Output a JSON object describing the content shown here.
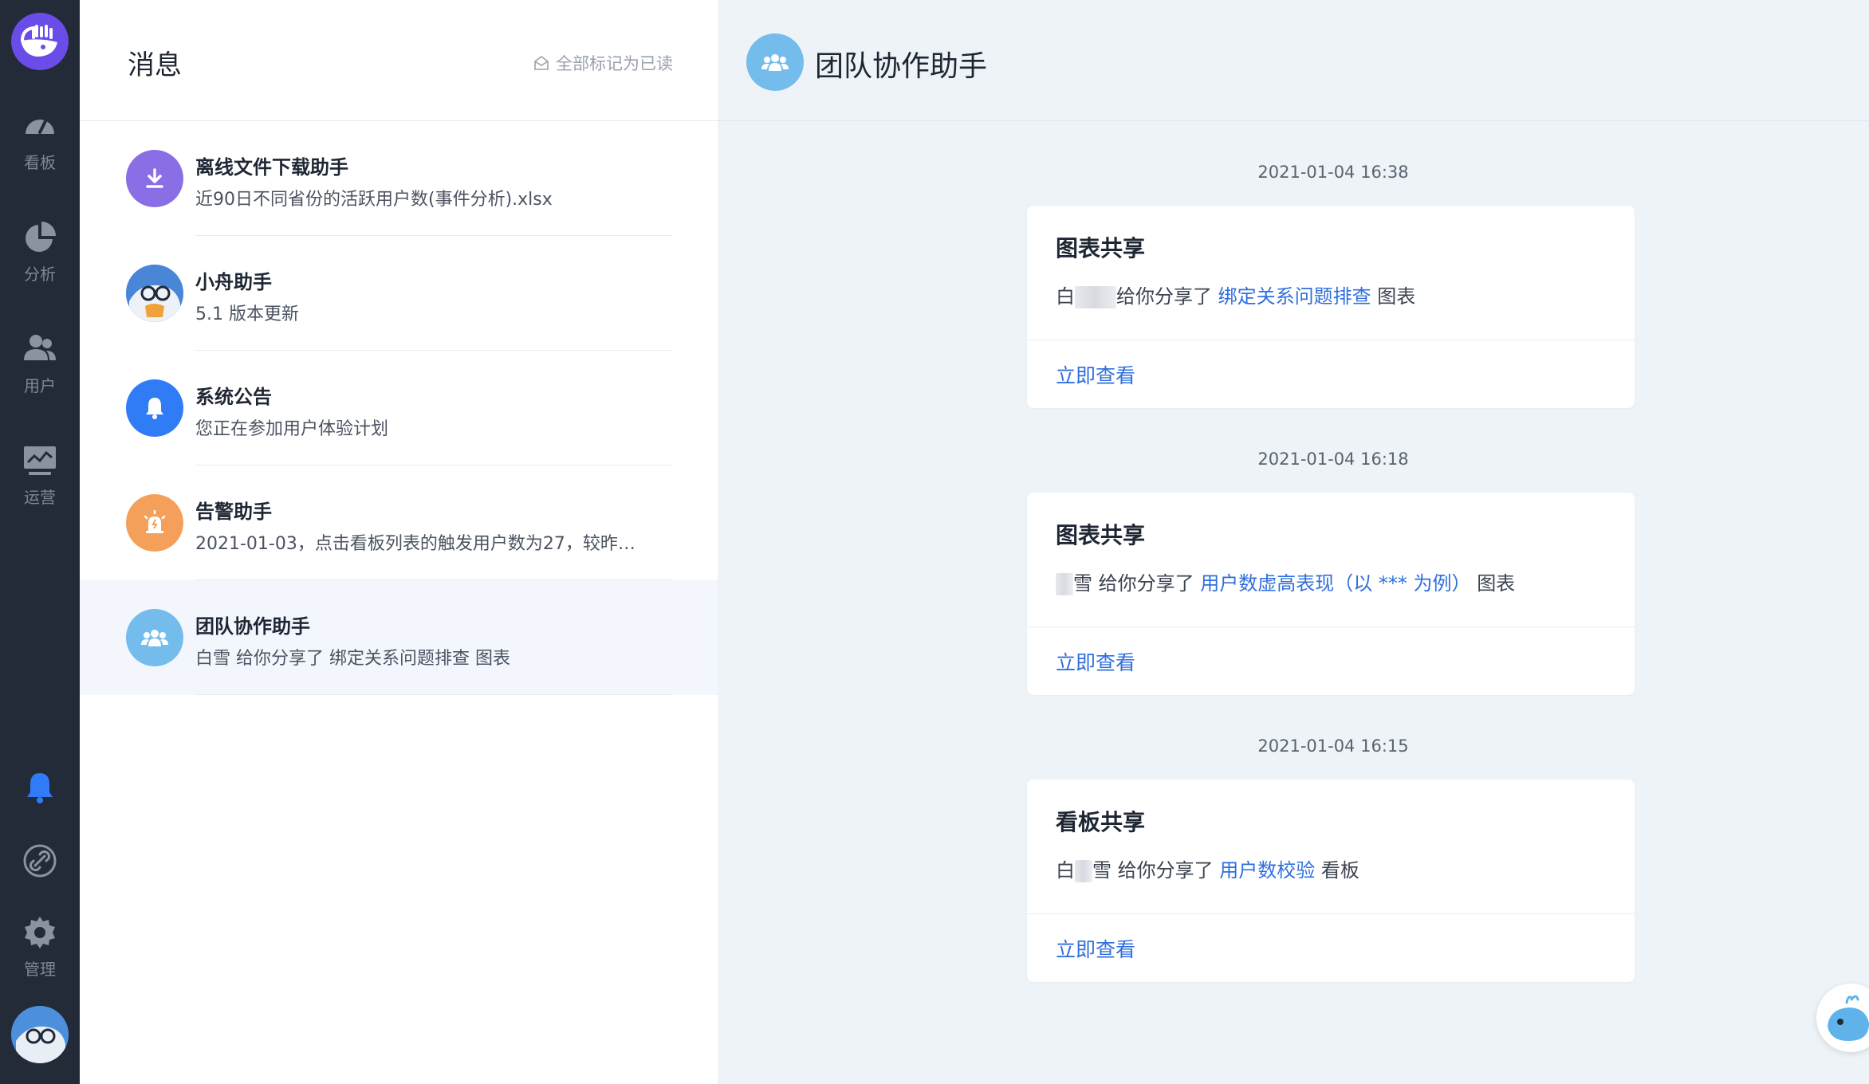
{
  "rail": {
    "items": [
      {
        "label": "看板",
        "icon": "gauge-icon"
      },
      {
        "label": "分析",
        "icon": "pie-chart-icon"
      },
      {
        "label": "用户",
        "icon": "users-icon"
      },
      {
        "label": "运营",
        "icon": "monitor-chart-icon"
      },
      {
        "label": "管理",
        "icon": "gear-icon"
      }
    ],
    "active_color": "#2f7cf6"
  },
  "list": {
    "title": "消息",
    "mark_all_read": "全部标记为已读",
    "items": [
      {
        "name": "离线文件下载助手",
        "preview": "近90日不同省份的活跃用户数(事件分析).xlsx",
        "color": "#8a6ee6",
        "icon": "download-icon"
      },
      {
        "name": "小舟助手",
        "preview": "5.1 版本更新",
        "color": "#4a86d8",
        "icon": "mascot-avatar"
      },
      {
        "name": "系统公告",
        "preview": "您正在参加用户体验计划",
        "color": "#2f7cf6",
        "icon": "bell-icon"
      },
      {
        "name": "告警助手",
        "preview": "2021-01-03，点击看板列表的触发用户数为27，较昨…",
        "color": "#f5a05a",
        "icon": "alarm-icon"
      },
      {
        "name": "团队协作助手",
        "preview": "白雪 给你分享了 绑定关系问题排查 图表",
        "color": "#74bcec",
        "icon": "team-icon"
      }
    ]
  },
  "detail": {
    "title": "团队协作助手",
    "messages": [
      {
        "time": "2021-01-04 16:38",
        "title": "图表共享",
        "sender_tail": "给你分享了",
        "link": "绑定关系问题排查",
        "suffix": "图表",
        "action": "立即查看",
        "sender_prefix": "白"
      },
      {
        "time": "2021-01-04 16:18",
        "title": "图表共享",
        "sender_tail": "雪 给你分享了",
        "link": "用户数虚高表现（以 *** 为例）",
        "suffix": "图表",
        "action": "立即查看",
        "sender_prefix": ""
      },
      {
        "time": "2021-01-04 16:15",
        "title": "看板共享",
        "sender_tail": "雪 给你分享了",
        "link": "用户数校验",
        "suffix": "看板",
        "action": "立即查看",
        "sender_prefix": "白"
      }
    ]
  }
}
